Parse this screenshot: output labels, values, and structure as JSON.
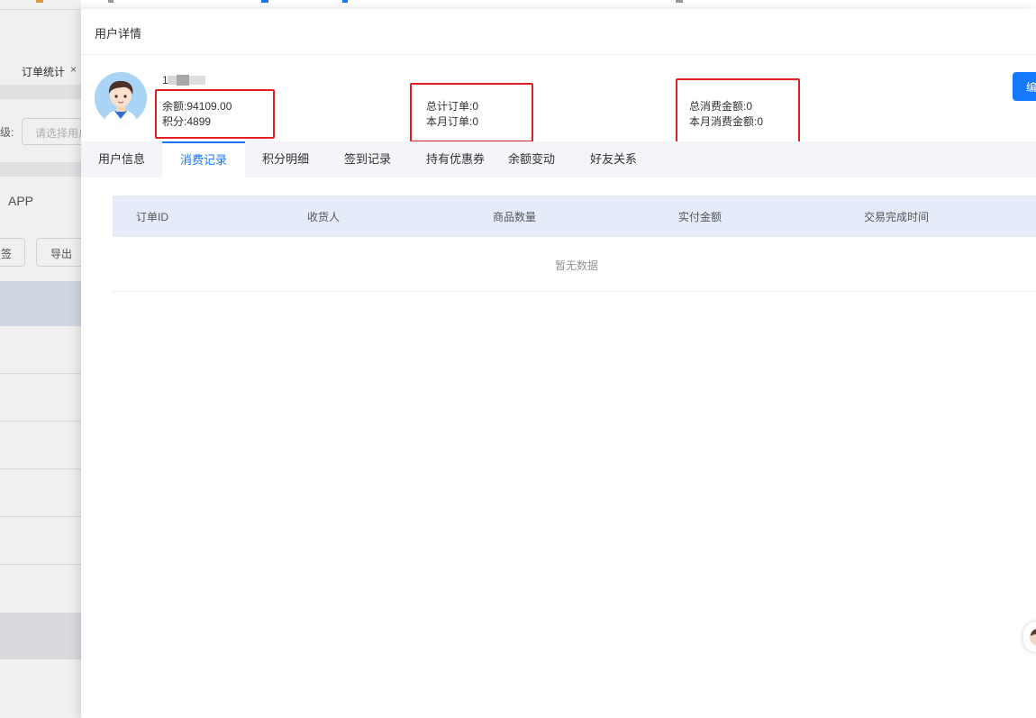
{
  "background": {
    "tab_label": "订单统计",
    "tab_close": "×",
    "filter_label": "级:",
    "select_placeholder": "请选择用户",
    "app_label": "APP",
    "button_tag": "签",
    "button_export": "导出"
  },
  "drawer": {
    "title": "用户详情",
    "user_name": "1",
    "stats": {
      "balance_label": "余额:",
      "balance_value": "94109.00",
      "points_label": "积分:",
      "points_value": "4899",
      "total_orders_label": "总计订单:",
      "total_orders_value": "0",
      "month_orders_label": "本月订单:",
      "month_orders_value": "0",
      "total_spend_label": "总消费金额:",
      "total_spend_value": "0",
      "month_spend_label": "本月消费金额:",
      "month_spend_value": "0"
    },
    "edit_button": "编",
    "tabs": [
      {
        "label": "用户信息"
      },
      {
        "label": "消费记录",
        "active": true
      },
      {
        "label": "积分明细"
      },
      {
        "label": "签到记录"
      },
      {
        "label": "持有优惠券"
      },
      {
        "label": "余额变动"
      },
      {
        "label": "好友关系"
      }
    ],
    "table": {
      "columns": [
        "订单ID",
        "收货人",
        "商品数量",
        "实付金额",
        "交易完成时间"
      ],
      "empty_text": "暂无数据"
    }
  },
  "colors": {
    "accent": "#1677ff",
    "highlight_box": "#e02020",
    "table_header_bg": "#e4ecfa",
    "tab_bar_bg": "#f4f5f9"
  }
}
